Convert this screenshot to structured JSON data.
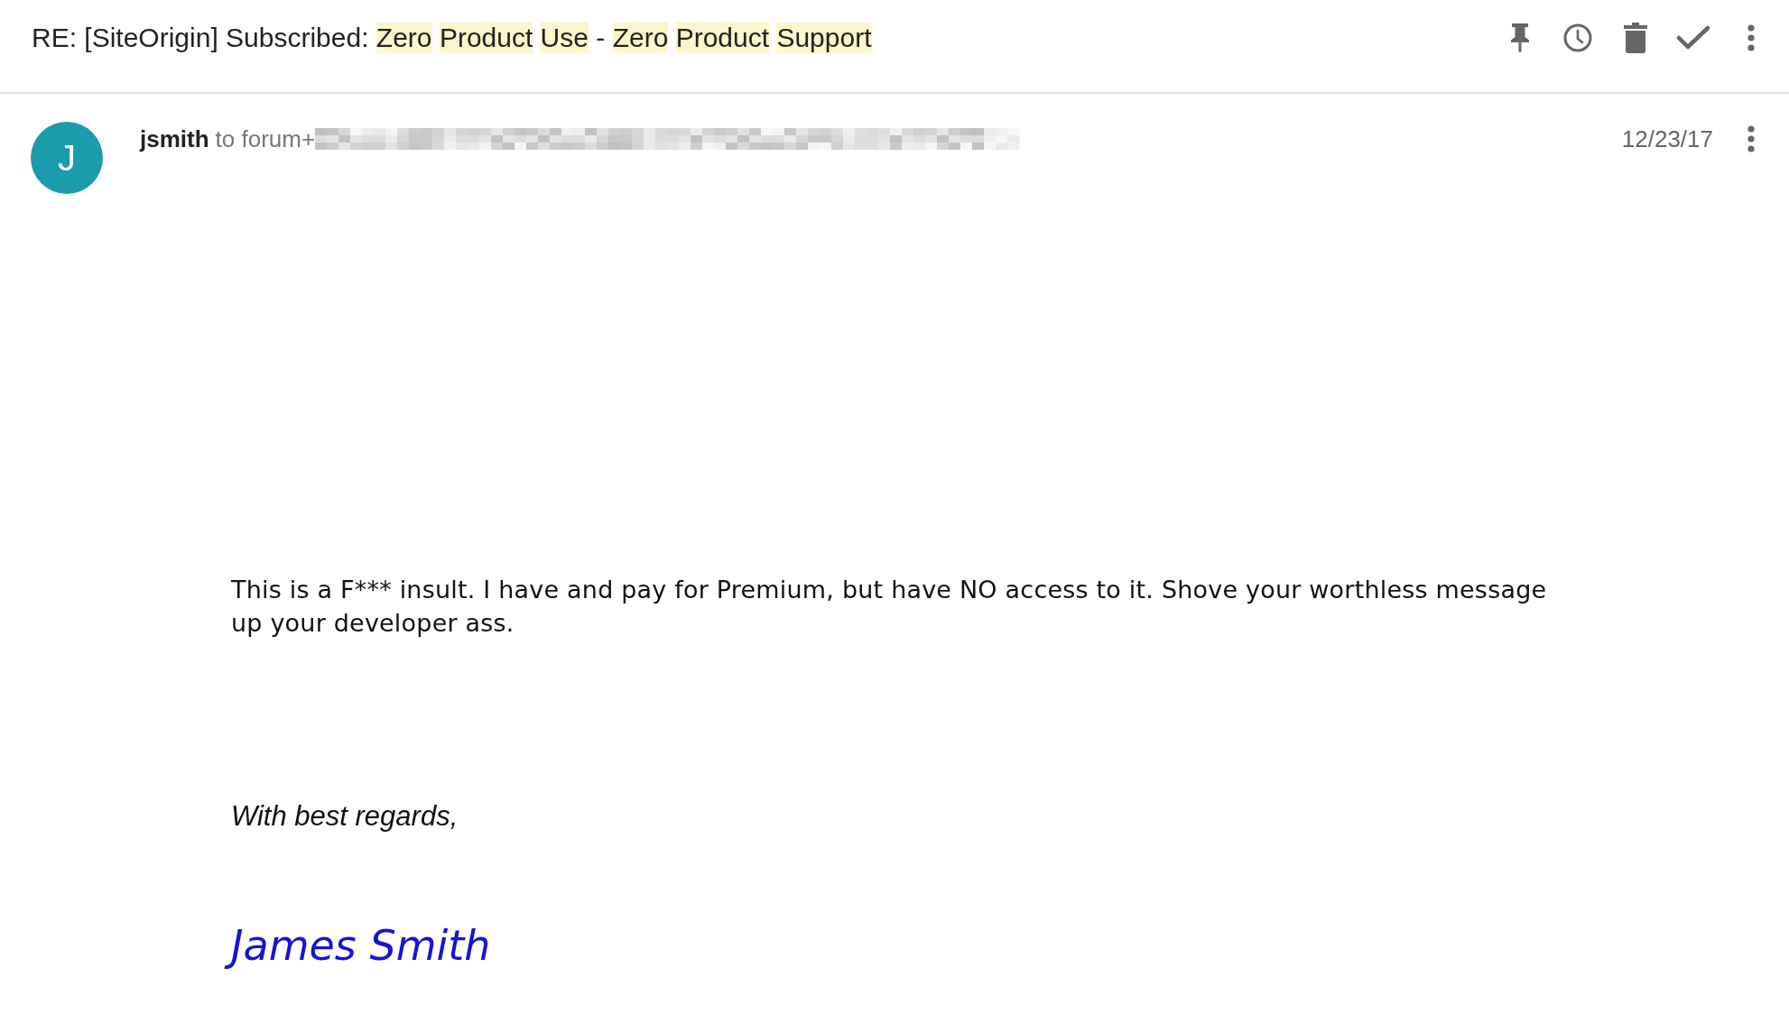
{
  "subject": {
    "segments": [
      {
        "text": "RE: [SiteOrigin] Subscribed:",
        "highlighted": false
      },
      {
        "text": "Zero",
        "highlighted": true
      },
      {
        "text": "Product",
        "highlighted": true
      },
      {
        "text": "Use",
        "highlighted": true
      },
      {
        "text": "-",
        "highlighted": false
      },
      {
        "text": "Zero",
        "highlighted": true
      },
      {
        "text": "Product",
        "highlighted": true
      },
      {
        "text": "Support",
        "highlighted": true
      }
    ]
  },
  "message": {
    "avatar_letter": "J",
    "sender": "jsmith",
    "recipient": "to forum+",
    "date": "12/23/17",
    "body": "This is a F*** insult. I have and pay for Premium, but have NO access to it. Shove your worthless message up your developer ass.",
    "closing": "With best regards,",
    "signature": "James Smith"
  }
}
